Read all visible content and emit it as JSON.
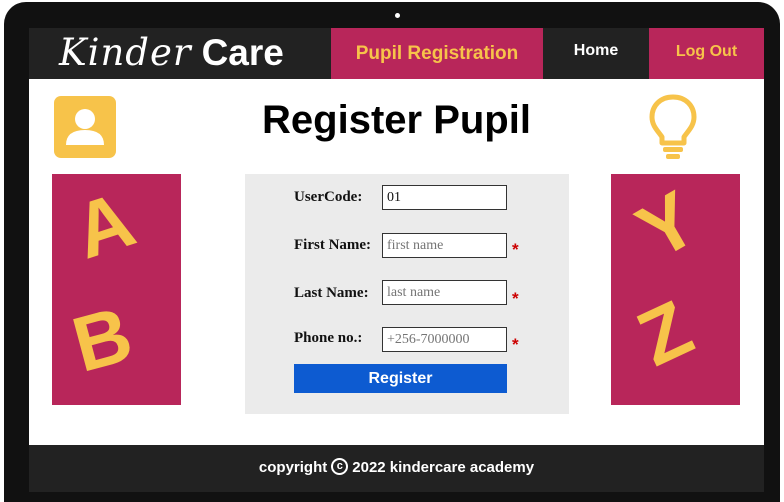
{
  "brand": {
    "first": "Kinder",
    "second": "Care"
  },
  "nav": {
    "active_label": "Pupil Registration",
    "home_label": "Home",
    "logout_label": "Log Out"
  },
  "page": {
    "title": "Register Pupil"
  },
  "icons": {
    "profile": "user-profile-icon",
    "idea": "lightbulb-icon",
    "copyright": "copyright-icon"
  },
  "panels": {
    "left_letters": [
      "A",
      "B"
    ],
    "right_letters": [
      "Y",
      "Z"
    ]
  },
  "form": {
    "fields": [
      {
        "label": "UserCode:",
        "value": "01",
        "placeholder": "",
        "required": false
      },
      {
        "label": "First Name:",
        "value": "",
        "placeholder": "first name",
        "required": true
      },
      {
        "label": "Last Name:",
        "value": "",
        "placeholder": "last name",
        "required": true
      },
      {
        "label": "Phone no.:",
        "value": "",
        "placeholder": "+256-7000000",
        "required": true
      }
    ],
    "required_mark": "*",
    "submit_label": "Register"
  },
  "footer": {
    "prefix": "copyright",
    "symbol": "c",
    "text": "2022 kindercare academy"
  },
  "colors": {
    "accent": "#b8265a",
    "highlight": "#f7c34a",
    "dark": "#222222",
    "button": "#0d5bd1",
    "form_bg": "#ebebeb",
    "required": "#cc0000"
  }
}
